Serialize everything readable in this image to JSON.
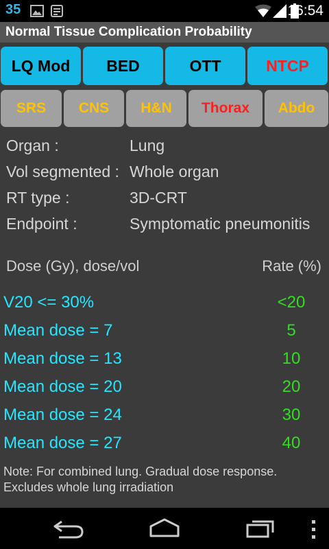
{
  "status_bar": {
    "notification_count": "35",
    "time": "16:54"
  },
  "title": "Normal Tissue Complication Probability",
  "tabs": [
    {
      "label": "LQ Mod",
      "color": "#000000"
    },
    {
      "label": "BED",
      "color": "#000000"
    },
    {
      "label": "OTT",
      "color": "#000000"
    },
    {
      "label": "NTCP",
      "color": "#ff1e1e",
      "selected": true
    }
  ],
  "categories": [
    {
      "label": "SRS",
      "color": "#ffc300"
    },
    {
      "label": "CNS",
      "color": "#ffc300"
    },
    {
      "label": "H&N",
      "color": "#ffc300"
    },
    {
      "label": "Thorax",
      "color": "#ff1e1e",
      "selected": true
    },
    {
      "label": "Abdo",
      "color": "#ffc300"
    }
  ],
  "info": {
    "organ_label": "Organ :",
    "organ_value": "Lung",
    "vol_label": "Vol segmented :",
    "vol_value": "Whole organ",
    "rt_label": "RT type :",
    "rt_value": "3D-CRT",
    "endpoint_label": "Endpoint :",
    "endpoint_value": "Symptomatic pneumonitis"
  },
  "table": {
    "dose_header": "Dose (Gy), dose/vol",
    "rate_header": "Rate (%)",
    "rows": [
      {
        "dose": "V20 <= 30%",
        "rate": "<20"
      },
      {
        "dose": "Mean dose = 7",
        "rate": "5"
      },
      {
        "dose": "Mean dose = 13",
        "rate": "10"
      },
      {
        "dose": "Mean dose = 20",
        "rate": "20"
      },
      {
        "dose": "Mean dose = 24",
        "rate": "30"
      },
      {
        "dose": "Mean dose = 27",
        "rate": "40"
      }
    ]
  },
  "note": "Note: For combined lung. Gradual dose response. Excludes whole lung irradiation",
  "icons": [
    "image-icon",
    "news-icon",
    "wifi-icon",
    "signal-icon",
    "battery-icon",
    "back-icon",
    "home-icon",
    "recent-apps-icon"
  ]
}
